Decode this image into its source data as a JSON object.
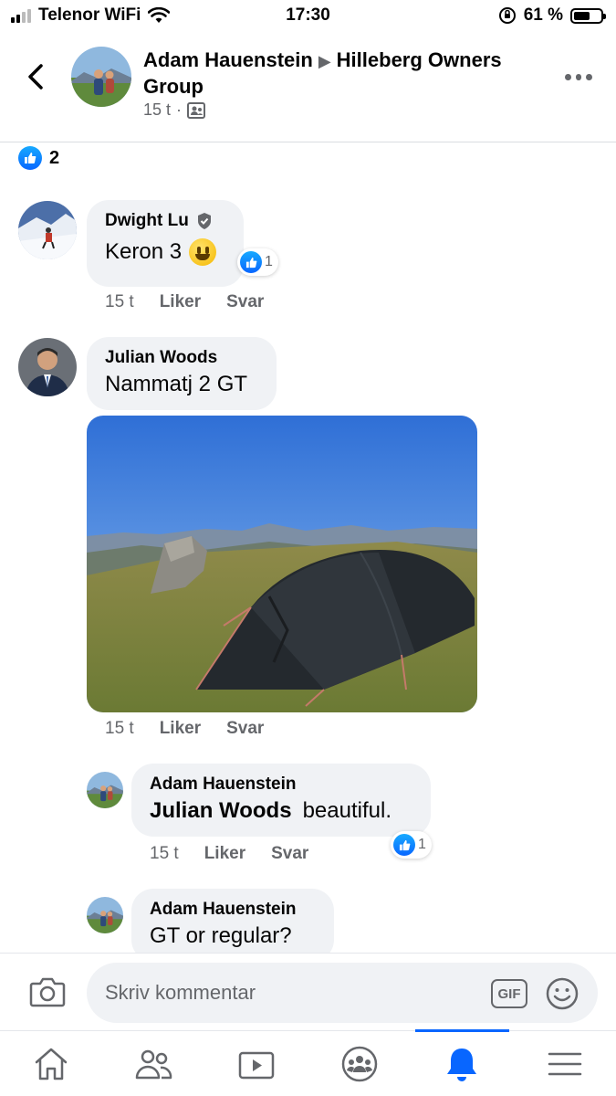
{
  "status_bar": {
    "carrier": "Telenor WiFi",
    "time": "17:30",
    "battery_percent": "61 %",
    "battery_level": 0.61
  },
  "header": {
    "author": "Adam Hauenstein",
    "group": "Hilleberg Owners Group",
    "time_ago": "15 t",
    "separator": "·",
    "back_icon": "chevron-left-icon",
    "more_icon": "more-dots-icon"
  },
  "post": {
    "reaction_count": "2"
  },
  "comments": [
    {
      "author": "Dwight Lu",
      "text": "Keron 3",
      "reaction_count": "1",
      "time_ago": "15 t",
      "like_label": "Liker",
      "reply_label": "Svar"
    },
    {
      "author": "Julian Woods",
      "text": "Nammatj 2 GT",
      "time_ago": "15 t",
      "like_label": "Liker",
      "reply_label": "Svar"
    },
    {
      "author": "Adam Hauenstein",
      "mention": "Julian Woods",
      "text": "beautiful.",
      "reaction_count": "1",
      "time_ago": "15 t",
      "like_label": "Liker",
      "reply_label": "Svar"
    },
    {
      "author": "Adam Hauenstein",
      "text": "GT or regular?"
    }
  ],
  "composer": {
    "placeholder": "Skriv kommentar",
    "gif_label": "GIF"
  },
  "tabbar": {
    "active": "notifications",
    "tabs": [
      "home-icon",
      "friends-icon",
      "watch-icon",
      "groups-icon",
      "notifications-icon",
      "menu-icon"
    ]
  },
  "colors": {
    "accent": "#0866ff",
    "bubble": "#f0f2f5",
    "secondary_text": "#65676b"
  }
}
